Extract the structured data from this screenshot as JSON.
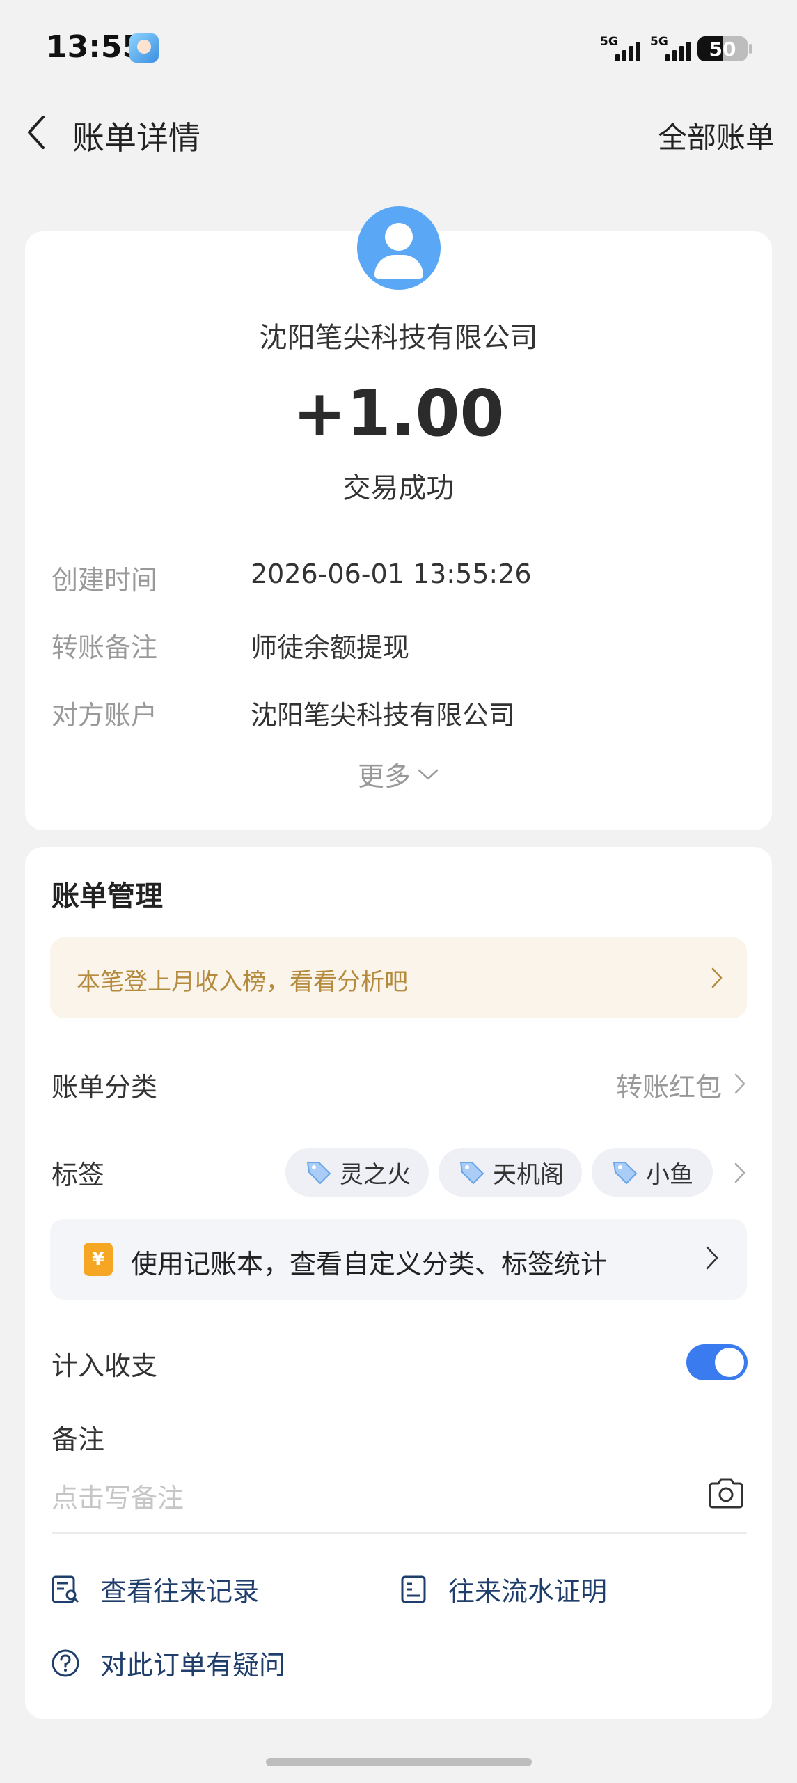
{
  "status_bar": {
    "time": "13:55",
    "signal1": "5G",
    "signal2": "5G",
    "battery": "50"
  },
  "nav": {
    "title": "账单详情",
    "right_link": "全部账单"
  },
  "detail": {
    "counterparty": "沈阳笔尖科技有限公司",
    "amount": "+1.00",
    "status": "交易成功",
    "rows": [
      {
        "label": "创建时间",
        "value": "2026-06-01 13:55:26"
      },
      {
        "label": "转账备注",
        "value": "师徒余额提现"
      },
      {
        "label": "对方账户",
        "value": "沈阳笔尖科技有限公司"
      }
    ],
    "more_label": "更多"
  },
  "management": {
    "title": "账单管理",
    "promo_text": "本笔登上月收入榜，看看分析吧",
    "category_label": "账单分类",
    "category_value": "转账红包",
    "tags_label": "标签",
    "tags": [
      "灵之火",
      "天机阁",
      "小鱼"
    ],
    "book_icon_text": "¥",
    "book_text": "使用记账本，查看自定义分类、标签统计",
    "include_label": "计入收支",
    "include_on": true,
    "note_label": "备注",
    "note_placeholder": "点击写备注",
    "links": {
      "history": "查看往来记录",
      "proof": "往来流水证明",
      "question": "对此订单有疑问"
    }
  },
  "colors": {
    "accent": "#3a7bf0",
    "link": "#1f3e6b",
    "promo_bg": "#fbf4ea",
    "promo_text": "#b48a3c",
    "avatar": "#5aa8f5"
  }
}
